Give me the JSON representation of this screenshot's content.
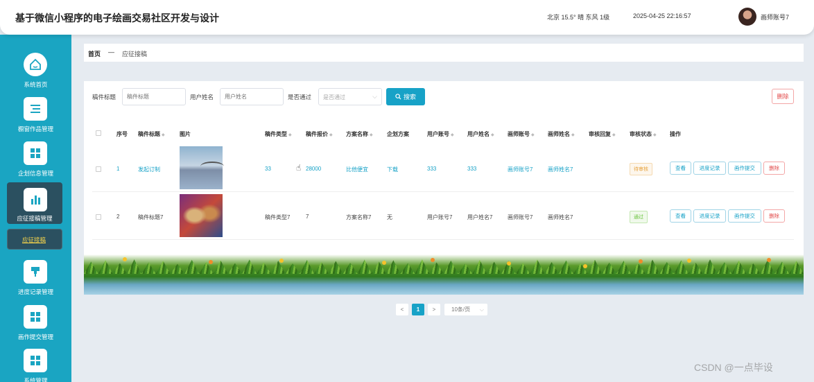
{
  "app": {
    "title": "基于微信小程序的电子绘画交易社区开发与设计",
    "weather": "北京  15.5°  晴  东风  1级",
    "datetime": "2025-04-25 22:16:57",
    "user": "画师账号7"
  },
  "sidebar": {
    "items": [
      {
        "label": "系统首页",
        "icon": "home-icon"
      },
      {
        "label": "橱窗作品管理",
        "icon": "list-icon"
      },
      {
        "label": "企划信息管理",
        "icon": "grid-icon"
      },
      {
        "label": "应征接稿管理",
        "icon": "bar-chart-icon"
      },
      {
        "label": "进度记录管理",
        "icon": "pin-icon"
      },
      {
        "label": "画作提交管理",
        "icon": "grid-icon"
      },
      {
        "label": "系统管理",
        "icon": "grid-icon"
      }
    ],
    "sub_item": "应征接稿"
  },
  "breadcrumb": {
    "home": "首页",
    "sep": "—",
    "current": "应征接稿"
  },
  "search": {
    "title_label": "稿件标题",
    "title_placeholder": "稿件标题",
    "user_label": "用户姓名",
    "user_placeholder": "用户姓名",
    "pass_label": "是否通过",
    "pass_placeholder": "是否通过",
    "search_button": "搜索",
    "delete_button": "删除"
  },
  "table": {
    "headers": [
      "序号",
      "稿件标题",
      "图片",
      "稿件类型",
      "稿件报价",
      "方案名称",
      "企划方案",
      "用户账号",
      "用户姓名",
      "画师账号",
      "画师姓名",
      "审核回复",
      "审核状态",
      "操作"
    ],
    "rows": [
      {
        "index": "1",
        "title": "发起订制",
        "type": "33",
        "price": "28000",
        "plan_name": "比他便宜",
        "plan": "下载",
        "user_account": "333",
        "user_name": "333",
        "artist_account": "画师账号7",
        "artist_name": "画师姓名7",
        "reply": "",
        "status": "待审核"
      },
      {
        "index": "2",
        "title": "稿件标题7",
        "type": "稿件类型7",
        "price": "7",
        "plan_name": "方案名称7",
        "plan": "无",
        "user_account": "用户账号7",
        "user_name": "用户姓名7",
        "artist_account": "画师账号7",
        "artist_name": "画师姓名7",
        "reply": "",
        "status": "通过"
      }
    ],
    "actions": [
      "查看",
      "进度记录",
      "画作提交",
      "删除"
    ]
  },
  "pagination": {
    "prev": "<",
    "page": "1",
    "next": ">",
    "page_size": "10条/页"
  },
  "watermark": "CSDN @一点毕设",
  "colors": {
    "accent": "#17a2c7",
    "sidebar": "#1aa5c2",
    "danger": "#e24b4b"
  }
}
